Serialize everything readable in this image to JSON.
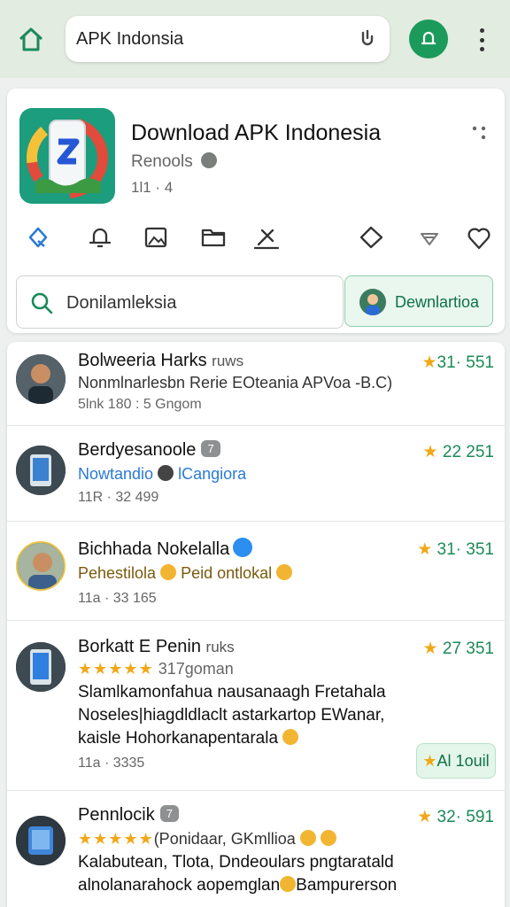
{
  "browser": {
    "url_text": "APK  Indonsia",
    "icons": [
      "home-icon",
      "mic-icon",
      "profile-icon",
      "more-vert-icon"
    ]
  },
  "app": {
    "title": "Download APK Indonesia",
    "subtitle": "Renools",
    "meta": "1l1 · 4",
    "action_icons": [
      "share-icon",
      "bell-icon",
      "image-icon",
      "folder-icon",
      "edit-icon",
      "tag-icon",
      "filter-icon",
      "heart-icon"
    ]
  },
  "search": {
    "text": "Donilamleksia",
    "download_label": "Dewnlartioa"
  },
  "rows": [
    {
      "name": "Bolweeria Harks",
      "tag": "ruws",
      "rating": "31· 551",
      "line1": "Nonmlnarlesbn Rerie EOteania  APVoa -B.C)",
      "line2": "5lnk 180 : 5 Gngom"
    },
    {
      "name": "Berdyesanoole",
      "badge": "7",
      "rating": "22  251",
      "line1": "Nowtandio",
      "line1b": "lCangiora",
      "meta": "11R · 32 499"
    },
    {
      "name": "Bichhada Nokelalla",
      "rating": "31· 351",
      "line1": "Pehestilola",
      "line1b": "Peid ontlokal",
      "meta": "11a · 33 165"
    },
    {
      "name": "Borkatt E Penin",
      "tag": "ruks",
      "rating": "27 351",
      "stars_label": "317goman",
      "desc1": "Slamlkamonfahua nausanaagh Fretahala",
      "desc2": "Noseles|hiagdldlaclt astarkartop EWanar,",
      "desc3": "kaisle Hohorkanapentarala",
      "meta": "11a · 3335",
      "ai_badge": "Al 1ouil"
    },
    {
      "name": "Pennlocik",
      "badge": "7",
      "rating": "32· 591",
      "stars_label": "(Ponidaar, GKmllioa",
      "desc1": "Kalabutean, Tlota, Dndeoulars pngtaratald",
      "desc2": "alnolanarahock aopemglan",
      "desc2b": "Bampurerson"
    }
  ],
  "colors": {
    "accent_green": "#1c9a5b",
    "star": "#f0a818",
    "verified_blue": "#2b8ef0",
    "header_bg": "#e3ece0"
  }
}
